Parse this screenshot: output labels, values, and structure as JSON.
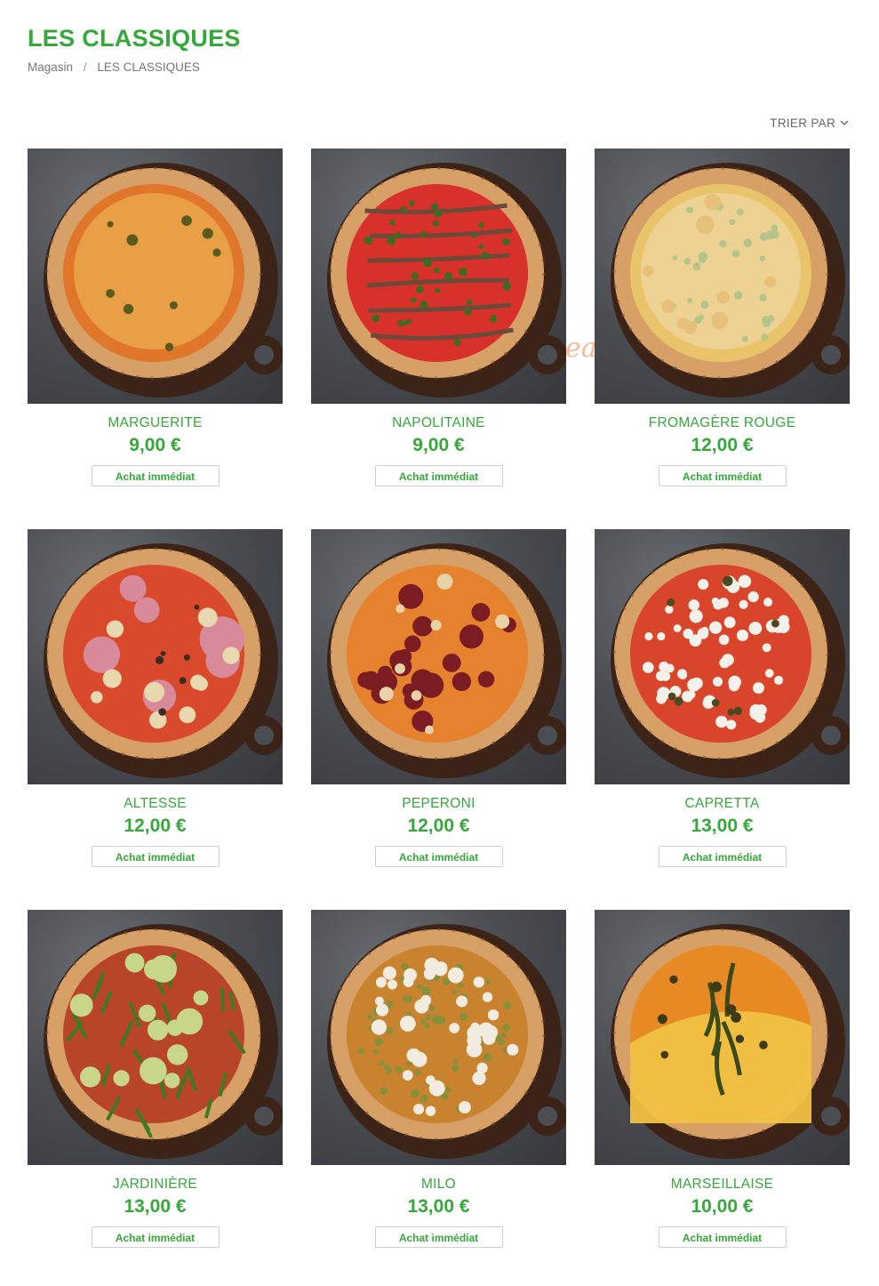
{
  "page": {
    "title": "LES CLASSIQUES"
  },
  "breadcrumb": {
    "home": "Magasin",
    "separator": "/",
    "current": "LES CLASSIQUES"
  },
  "sort": {
    "label": "TRIER PAR"
  },
  "watermark": "eat-list.fr",
  "colors": {
    "accent": "#35a83a",
    "text_muted": "#777777",
    "border": "#cfcfcf"
  },
  "products": [
    {
      "name": "MARGUERITE",
      "price": "9,00 €",
      "button": "Achat immédiat",
      "topping": "cheese-olives"
    },
    {
      "name": "NAPOLITAINE",
      "price": "9,00 €",
      "button": "Achat immédiat",
      "topping": "tomato-anchovies-capers"
    },
    {
      "name": "FROMAGÈRE ROUGE",
      "price": "12,00 €",
      "button": "Achat immédiat",
      "topping": "four-cheese"
    },
    {
      "name": "ALTESSE",
      "price": "12,00 €",
      "button": "Achat immédiat",
      "topping": "ham-mushrooms"
    },
    {
      "name": "PEPERONI",
      "price": "12,00 €",
      "button": "Achat immédiat",
      "topping": "pepperoni"
    },
    {
      "name": "CAPRETTA",
      "price": "13,00 €",
      "button": "Achat immédiat",
      "topping": "goat-cheese"
    },
    {
      "name": "JARDINIÈRE",
      "price": "13,00 €",
      "button": "Achat immédiat",
      "topping": "zucchini-rocket"
    },
    {
      "name": "MILO",
      "price": "13,00 €",
      "button": "Achat immédiat",
      "topping": "feta-pesto"
    },
    {
      "name": "MARSEILLAISE",
      "price": "10,00 €",
      "button": "Achat immédiat",
      "topping": "half-cheese-half-tomato"
    }
  ]
}
